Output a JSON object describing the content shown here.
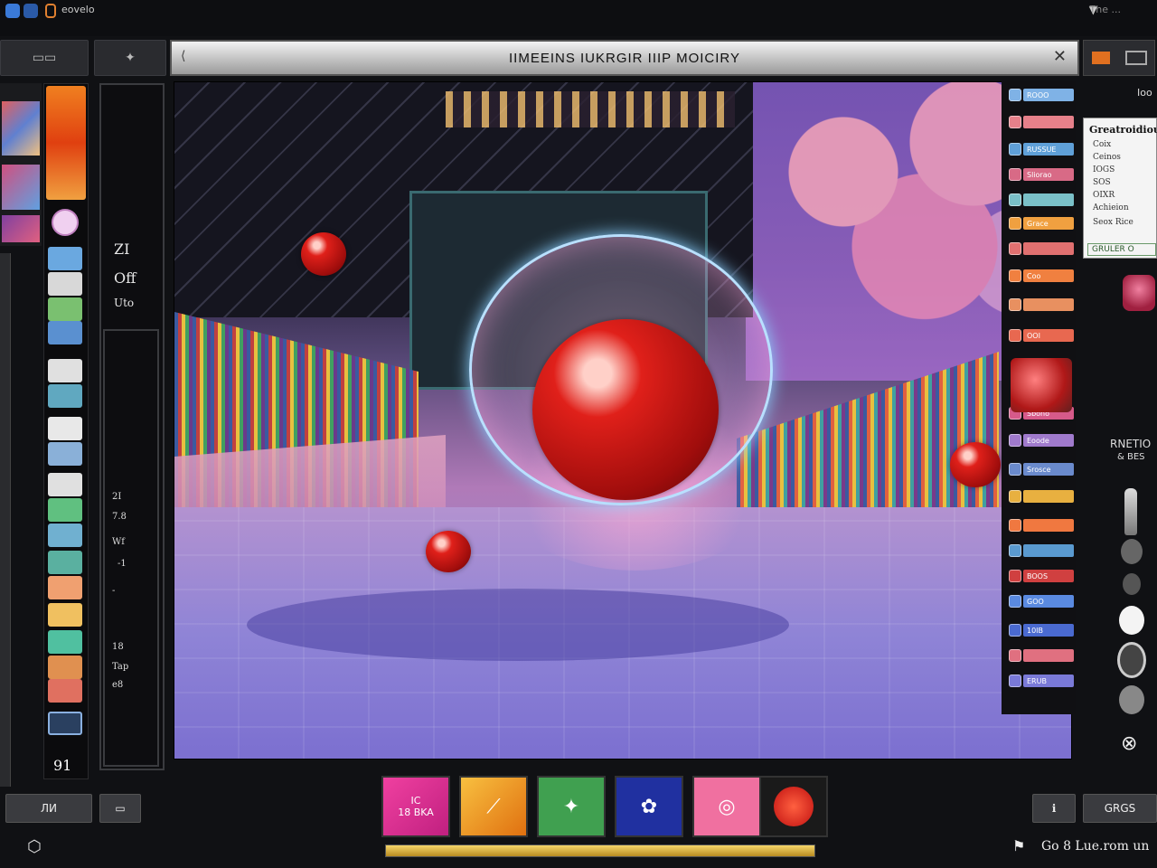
{
  "system_bar": {
    "app_name": "eovelo",
    "right_text": "The ..."
  },
  "title_bar": {
    "title": "IIMEEINS IUKRGIR IIIP MOICIRY"
  },
  "left_panel": {
    "mid_labels": [
      "ZI",
      "Off",
      "Uto"
    ],
    "mid_small_labels": [
      "2I",
      "7.8",
      "Wf",
      "-1",
      "-",
      "18",
      "Tap",
      "e8"
    ],
    "bottom_glyph": "91",
    "bottom_button_label": "ЛИ"
  },
  "item_list": {
    "items": [
      {
        "label": "ROOO",
        "color": "#7fb2e6"
      },
      {
        "label": "",
        "color": "#e6808a"
      },
      {
        "label": "RUSSUE",
        "color": "#5fa0d8"
      },
      {
        "label": "Sliorao",
        "color": "#d86a86"
      },
      {
        "label": "",
        "color": "#7ac0c8"
      },
      {
        "label": "Grace",
        "color": "#f0a040"
      },
      {
        "label": "",
        "color": "#e07070"
      },
      {
        "label": "Coo",
        "color": "#f08040"
      },
      {
        "label": "",
        "color": "#e89060"
      },
      {
        "label": "OOI",
        "color": "#e86850"
      },
      {
        "label": "Sbono",
        "color": "#d65a8a"
      },
      {
        "label": "Eoode",
        "color": "#a07acc"
      },
      {
        "label": "Srosce",
        "color": "#6a8acc"
      },
      {
        "label": "",
        "color": "#e8b040"
      },
      {
        "label": "",
        "color": "#f07840"
      },
      {
        "label": "",
        "color": "#5a9ad0"
      },
      {
        "label": "BOOS",
        "color": "#d04040"
      },
      {
        "label": "GOO",
        "color": "#5a8ae0"
      },
      {
        "label": "10IB",
        "color": "#4a6ad0"
      },
      {
        "label": "",
        "color": "#e07080"
      },
      {
        "label": "ERUB",
        "color": "#7a7ad8"
      }
    ]
  },
  "right_panel": {
    "top_label": "Ioo",
    "dropdown": {
      "title": "Greatroidiou",
      "items": [
        "Coix",
        "Ceinos",
        "IOGS",
        "SOS",
        "OIXR",
        "Achieion",
        "Seox Rice"
      ],
      "footer": "GRULER O"
    },
    "side_label_1": "RNETIO",
    "side_label_2": "& BES",
    "bottom_button_label": "GRGS"
  },
  "hotbar": {
    "slot_1_label": "IC\n18 BKA",
    "slots": [
      "slot-magenta",
      "slot-orange",
      "slot-green",
      "slot-blue",
      "slot-pink",
      "slot-red"
    ]
  },
  "progress": {
    "value_percent": 100
  },
  "bottom_status": "Go 8 Lue.rom un",
  "colors": {
    "accent_gold": "#f6d66a",
    "ball_red": "#e0201a",
    "orb_ring": "#b9e0ff"
  }
}
